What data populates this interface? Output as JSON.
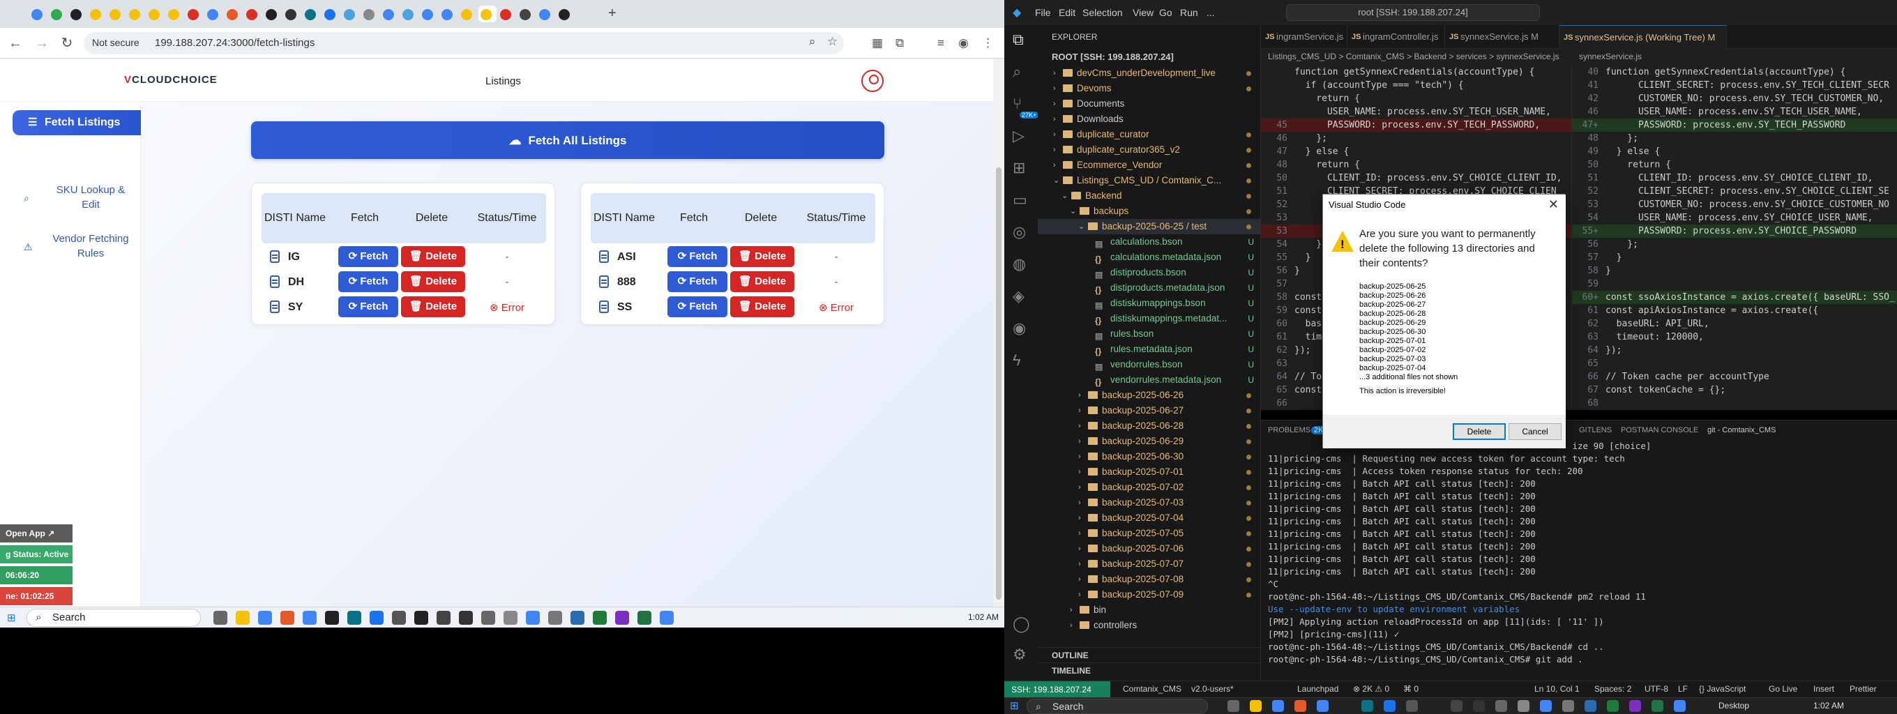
{
  "browser": {
    "security_label": "Not secure",
    "url": "199.188.207.24:3000/fetch-listings"
  },
  "app": {
    "logo_v": "V",
    "logo_rest": "CLOUDCHOICE",
    "nav_title": "Listings",
    "sidebar": [
      {
        "label": "Fetch Listings",
        "icon": "list-icon",
        "active": true
      },
      {
        "label": "SKU Lookup & Edit",
        "icon": "search-icon",
        "active": false
      },
      {
        "label": "Vendor Fetching Rules",
        "icon": "warning-triangle-icon",
        "active": false
      }
    ],
    "fetch_all_label": "Fetch All Listings",
    "columns": [
      "DISTI Name",
      "Fetch",
      "Delete",
      "Status/Time"
    ],
    "fetch_label": "Fetch",
    "delete_label": "Delete",
    "tables": [
      {
        "rows": [
          {
            "name": "IG",
            "status": "-",
            "error": false
          },
          {
            "name": "DH",
            "status": "-",
            "error": false
          },
          {
            "name": "SY",
            "status": "Error",
            "error": true
          }
        ]
      },
      {
        "rows": [
          {
            "name": "ASI",
            "status": "-",
            "error": false
          },
          {
            "name": "888",
            "status": "-",
            "error": false
          },
          {
            "name": "SS",
            "status": "Error",
            "error": true
          }
        ]
      }
    ]
  },
  "overlay": {
    "open_app": "Open App ↗",
    "status": "g Status: Active",
    "time1": "06:06:20",
    "time2": "ne: 01:02:25"
  },
  "taskbar_left": {
    "search": "Search",
    "clock": "1:02 AM"
  },
  "vscode": {
    "menus": [
      "File",
      "Edit",
      "Selection",
      "View",
      "Go",
      "Run",
      "..."
    ],
    "command_center": "root [SSH: 199.188.207.24]",
    "explorer_title": "EXPLORER",
    "root_label": "ROOT [SSH: 199.188.207.24]",
    "badge": "27K+",
    "tree": [
      {
        "label": "devCms_underDevelopment_live",
        "depth": 1,
        "kind": "folder",
        "open": false,
        "mark": "dot"
      },
      {
        "label": "Devoms",
        "depth": 1,
        "kind": "folder",
        "open": false,
        "mark": "dot"
      },
      {
        "label": "Documents",
        "depth": 1,
        "kind": "folder",
        "open": false,
        "mark": ""
      },
      {
        "label": "Downloads",
        "depth": 1,
        "kind": "folder",
        "open": false,
        "mark": ""
      },
      {
        "label": "duplicate_curator",
        "depth": 1,
        "kind": "folder",
        "open": false,
        "mark": "dot"
      },
      {
        "label": "duplicate_curator365_v2",
        "depth": 1,
        "kind": "folder",
        "open": false,
        "mark": "dot"
      },
      {
        "label": "Ecommerce_Vendor",
        "depth": 1,
        "kind": "folder",
        "open": false,
        "mark": "dot"
      },
      {
        "label": "Listings_CMS_UD / Comtanix_C...",
        "depth": 1,
        "kind": "folder",
        "open": true,
        "mark": "dot"
      },
      {
        "label": "Backend",
        "depth": 2,
        "kind": "folder",
        "open": true,
        "mark": "dot"
      },
      {
        "label": "backups",
        "depth": 3,
        "kind": "folder",
        "open": true,
        "mark": "dot"
      },
      {
        "label": "backup-2025-06-25 / test",
        "depth": 4,
        "kind": "folder",
        "open": true,
        "mark": "dot",
        "selected": true
      },
      {
        "label": "calculations.bson",
        "depth": 5,
        "kind": "file",
        "mark": "U"
      },
      {
        "label": "calculations.metadata.json",
        "depth": 5,
        "kind": "json",
        "mark": "U"
      },
      {
        "label": "distiproducts.bson",
        "depth": 5,
        "kind": "file",
        "mark": "U"
      },
      {
        "label": "distiproducts.metadata.json",
        "depth": 5,
        "kind": "json",
        "mark": "U"
      },
      {
        "label": "distiskumappings.bson",
        "depth": 5,
        "kind": "file",
        "mark": "U"
      },
      {
        "label": "distiskumappings.metadat...",
        "depth": 5,
        "kind": "json",
        "mark": "U"
      },
      {
        "label": "rules.bson",
        "depth": 5,
        "kind": "file",
        "mark": "U"
      },
      {
        "label": "rules.metadata.json",
        "depth": 5,
        "kind": "json",
        "mark": "U"
      },
      {
        "label": "vendorrules.bson",
        "depth": 5,
        "kind": "file",
        "mark": "U"
      },
      {
        "label": "vendorrules.metadata.json",
        "depth": 5,
        "kind": "json",
        "mark": "U"
      },
      {
        "label": "backup-2025-06-26",
        "depth": 4,
        "kind": "folder",
        "open": false,
        "mark": "dot"
      },
      {
        "label": "backup-2025-06-27",
        "depth": 4,
        "kind": "folder",
        "open": false,
        "mark": "dot"
      },
      {
        "label": "backup-2025-06-28",
        "depth": 4,
        "kind": "folder",
        "open": false,
        "mark": "dot"
      },
      {
        "label": "backup-2025-06-29",
        "depth": 4,
        "kind": "folder",
        "open": false,
        "mark": "dot"
      },
      {
        "label": "backup-2025-06-30",
        "depth": 4,
        "kind": "folder",
        "open": false,
        "mark": "dot"
      },
      {
        "label": "backup-2025-07-01",
        "depth": 4,
        "kind": "folder",
        "open": false,
        "mark": "dot"
      },
      {
        "label": "backup-2025-07-02",
        "depth": 4,
        "kind": "folder",
        "open": false,
        "mark": "dot"
      },
      {
        "label": "backup-2025-07-03",
        "depth": 4,
        "kind": "folder",
        "open": false,
        "mark": "dot"
      },
      {
        "label": "backup-2025-07-04",
        "depth": 4,
        "kind": "folder",
        "open": false,
        "mark": "dot"
      },
      {
        "label": "backup-2025-07-05",
        "depth": 4,
        "kind": "folder",
        "open": false,
        "mark": "dot"
      },
      {
        "label": "backup-2025-07-06",
        "depth": 4,
        "kind": "folder",
        "open": false,
        "mark": "dot"
      },
      {
        "label": "backup-2025-07-07",
        "depth": 4,
        "kind": "folder",
        "open": false,
        "mark": "dot"
      },
      {
        "label": "backup-2025-07-08",
        "depth": 4,
        "kind": "folder",
        "open": false,
        "mark": "dot"
      },
      {
        "label": "backup-2025-07-09",
        "depth": 4,
        "kind": "folder",
        "open": false,
        "mark": "dot"
      },
      {
        "label": "bin",
        "depth": 3,
        "kind": "folder",
        "open": false,
        "mark": ""
      },
      {
        "label": "controllers",
        "depth": 3,
        "kind": "folder",
        "open": false,
        "mark": ""
      }
    ],
    "outline": "OUTLINE",
    "timeline": "TIMELINE",
    "tabs": [
      {
        "label": "ingramService.js"
      },
      {
        "label": "ingramController.js"
      },
      {
        "label": "synnexService.js M"
      },
      {
        "label": "synnexService.js (Working Tree) M",
        "active": true
      }
    ],
    "breadcrumb_left": "Listings_CMS_UD > Comtanix_CMS > Backend > services > synnexService.js",
    "breadcrumb_right": "synnexService.js",
    "left_code": [
      {
        "n": "",
        "t": "function getSynnexCredentials(accountType) {",
        "s": ""
      },
      {
        "n": "",
        "t": "  if (accountType === \"tech\") {",
        "s": ""
      },
      {
        "n": "",
        "t": "    return {",
        "s": ""
      },
      {
        "n": "",
        "t": "      USER_NAME: process.env.SY_TECH_USER_NAME,",
        "s": ""
      },
      {
        "n": "45",
        "t": "      PASSWORD: process.env.SY_TECH_PASSWORD,",
        "s": "del"
      },
      {
        "n": "46",
        "t": "    };",
        "s": ""
      },
      {
        "n": "47",
        "t": "  } else {",
        "s": ""
      },
      {
        "n": "48",
        "t": "    return {",
        "s": ""
      },
      {
        "n": "50",
        "t": "      CLIENT_ID: process.env.SY_CHOICE_CLIENT_ID,",
        "s": ""
      },
      {
        "n": "51",
        "t": "      CLIENT_SECRET: process.env.SY_CHOICE_CLIEN",
        "s": ""
      },
      {
        "n": "52",
        "t": "      CUSTOMER_NO:",
        "s": ""
      },
      {
        "n": "53",
        "t": "      USER_NAME:",
        "s": ""
      },
      {
        "n": "53",
        "t": "      PASS",
        "s": "del"
      },
      {
        "n": "54",
        "t": "    };",
        "s": ""
      },
      {
        "n": "55",
        "t": "  }",
        "s": ""
      },
      {
        "n": "56",
        "t": "}",
        "s": ""
      },
      {
        "n": "57",
        "t": "",
        "s": ""
      },
      {
        "n": "58",
        "t": "const ssoA",
        "s": ""
      },
      {
        "n": "59",
        "t": "const apiA",
        "s": ""
      },
      {
        "n": "60",
        "t": "  baseURL:",
        "s": ""
      },
      {
        "n": "61",
        "t": "  timeout",
        "s": ""
      },
      {
        "n": "62",
        "t": "});",
        "s": ""
      },
      {
        "n": "63",
        "t": "",
        "s": ""
      },
      {
        "n": "64",
        "t": "// Token",
        "s": ""
      },
      {
        "n": "65",
        "t": "const toke",
        "s": ""
      },
      {
        "n": "66",
        "t": "",
        "s": ""
      }
    ],
    "right_code": [
      {
        "n": "40",
        "t": "function getSynnexCredentials(accountType) {",
        "s": ""
      },
      {
        "n": "41",
        "t": "      CLIENT_SECRET: process.env.SY_TECH_CLIENT_SECR",
        "s": ""
      },
      {
        "n": "42",
        "t": "      CUSTOMER_NO: process.env.SY_TECH_CUSTOMER_NO,",
        "s": ""
      },
      {
        "n": "46",
        "t": "      USER_NAME: process.env.SY_TECH_USER_NAME,",
        "s": ""
      },
      {
        "n": "47+",
        "t": "      PASSWORD: process.env.SY_TECH_PASSWORD",
        "s": "add"
      },
      {
        "n": "48",
        "t": "    };",
        "s": ""
      },
      {
        "n": "49",
        "t": "  } else {",
        "s": ""
      },
      {
        "n": "50",
        "t": "    return {",
        "s": ""
      },
      {
        "n": "51",
        "t": "      CLIENT_ID: process.env.SY_CHOICE_CLIENT_ID,",
        "s": ""
      },
      {
        "n": "52",
        "t": "      CLIENT_SECRET: process.env.SY_CHOICE_CLIENT_SE",
        "s": ""
      },
      {
        "n": "53",
        "t": "      CUSTOMER_NO: process.env.SY_CHOICE_CUSTOMER_NO",
        "s": ""
      },
      {
        "n": "54",
        "t": "      USER_NAME: process.env.SY_CHOICE_USER_NAME,",
        "s": ""
      },
      {
        "n": "55+",
        "t": "      PASSWORD: process.env.SY_CHOICE_PASSWORD",
        "s": "add"
      },
      {
        "n": "56",
        "t": "    };",
        "s": ""
      },
      {
        "n": "57",
        "t": "  }",
        "s": ""
      },
      {
        "n": "58",
        "t": "}",
        "s": ""
      },
      {
        "n": "59",
        "t": "",
        "s": ""
      },
      {
        "n": "60+",
        "t": "const ssoAxiosInstance = axios.create({ baseURL: SSO_",
        "s": "add"
      },
      {
        "n": "61",
        "t": "const apiAxiosInstance = axios.create({",
        "s": ""
      },
      {
        "n": "62",
        "t": "  baseURL: API_URL,",
        "s": ""
      },
      {
        "n": "63",
        "t": "  timeout: 120000,",
        "s": ""
      },
      {
        "n": "64",
        "t": "});",
        "s": ""
      },
      {
        "n": "65",
        "t": "",
        "s": ""
      },
      {
        "n": "66",
        "t": "// Token cache per accountType",
        "s": ""
      },
      {
        "n": "67",
        "t": "const tokenCache = {};",
        "s": ""
      },
      {
        "n": "68",
        "t": "",
        "s": ""
      },
      {
        "n": "69",
        "t": "async function getSynnexAccessToken(accountType = \"cl",
        "s": ""
      }
    ],
    "panel_tabs": [
      "PROBLEMS",
      "2K+",
      "GITLENS",
      "POSTMAN CONSOLE",
      "git - Comtanix_CMS"
    ],
    "terminal": [
      {
        "t": "                                                          ize 90 [choice]",
        "c": "#cccccc"
      },
      {
        "t": "11|pricing-cms  | Requesting new access token for account type: tech",
        "c": "#cccccc"
      },
      {
        "t": "11|pricing-cms  | Access token response status for tech: 200",
        "c": "#cccccc"
      },
      {
        "t": "11|pricing-cms  | Batch API call status [tech]: 200",
        "c": "#cccccc"
      },
      {
        "t": "11|pricing-cms  | Batch API call status [tech]: 200",
        "c": "#cccccc"
      },
      {
        "t": "11|pricing-cms  | Batch API call status [tech]: 200",
        "c": "#cccccc"
      },
      {
        "t": "11|pricing-cms  | Batch API call status [tech]: 200",
        "c": "#cccccc"
      },
      {
        "t": "11|pricing-cms  | Batch API call status [tech]: 200",
        "c": "#cccccc"
      },
      {
        "t": "11|pricing-cms  | Batch API call status [tech]: 200",
        "c": "#cccccc"
      },
      {
        "t": "11|pricing-cms  | Batch API call status [tech]: 200",
        "c": "#cccccc"
      },
      {
        "t": "11|pricing-cms  | Batch API call status [tech]: 200",
        "c": "#cccccc"
      },
      {
        "t": "^C",
        "c": "#cccccc"
      },
      {
        "t": "root@nc-ph-1564-48:~/Listings_CMS_UD/Comtanix_CMS/Backend# pm2 reload 11",
        "c": "#cccccc"
      },
      {
        "t": "Use --update-env to update environment variables",
        "c": "#3b8eea"
      },
      {
        "t": "[PM2] Applying action reloadProcessId on app [11](ids: [ '11' ])",
        "c": "#cccccc"
      },
      {
        "t": "[PM2] [pricing-cms](11) ✓",
        "c": "#cccccc"
      },
      {
        "t": "root@nc-ph-1564-48:~/Listings_CMS_UD/Comtanix_CMS/Backend# cd ..",
        "c": "#cccccc"
      },
      {
        "t": "root@nc-ph-1564-48:~/Listings_CMS_UD/Comtanix_CMS# git add .",
        "c": "#cccccc"
      }
    ],
    "status": {
      "ssh": "SSH: 199.188.207.24",
      "branch": "Comtanix_CMS",
      "version": "v2.0-users*",
      "launchpad": "Launchpad",
      "problems": "⊗ 2K ⚠ 0",
      "ports": "⌘ 0",
      "position": "Ln 10, Col 1",
      "spaces": "Spaces: 2",
      "encoding": "UTF-8",
      "eol": "LF",
      "lang": "{} JavaScript",
      "golive": "Go Live",
      "insert": "Insert",
      "prettier": "Prettier"
    },
    "taskbar": {
      "search": "Search",
      "desktop": "Desktop",
      "clock": "1:02 AM"
    }
  },
  "dialog": {
    "title": "Visual Studio Code",
    "message": "Are you sure you want to permanently delete the following 13 directories and their contents?",
    "items": [
      "backup-2025-06-25",
      "backup-2025-06-26",
      "backup-2025-06-27",
      "backup-2025-06-28",
      "backup-2025-06-29",
      "backup-2025-06-30",
      "backup-2025-07-01",
      "backup-2025-07-02",
      "backup-2025-07-03",
      "backup-2025-07-04",
      "...3 additional files not shown"
    ],
    "warning": "This action is irreversible!",
    "delete_label": "Delete",
    "cancel_label": "Cancel"
  }
}
